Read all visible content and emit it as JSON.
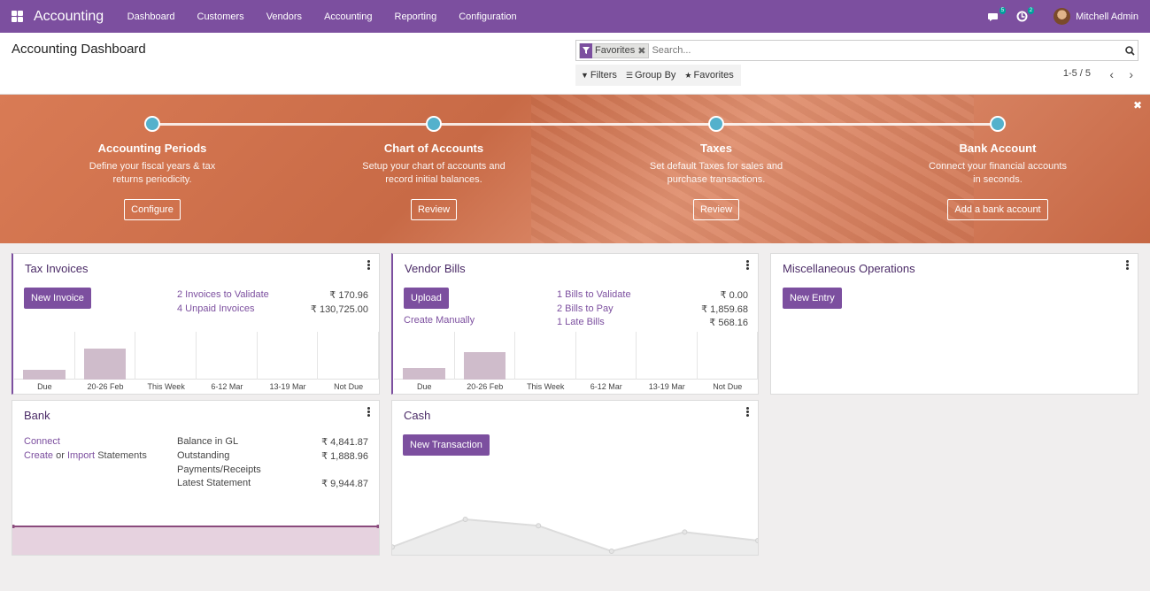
{
  "nav": {
    "app_name": "Accounting",
    "menu": [
      "Dashboard",
      "Customers",
      "Vendors",
      "Accounting",
      "Reporting",
      "Configuration"
    ],
    "messages_count": "5",
    "activities_count": "2",
    "user_name": "Mitchell Admin"
  },
  "control": {
    "title": "Accounting Dashboard",
    "facet_label": "Favorites",
    "search_placeholder": "Search...",
    "filters_label": "Filters",
    "groupby_label": "Group By",
    "favorites_label": "Favorites",
    "pager": "1-5 / 5"
  },
  "onboarding": {
    "steps": [
      {
        "title": "Accounting Periods",
        "desc": "Define your fiscal years & tax returns periodicity.",
        "button": "Configure"
      },
      {
        "title": "Chart of Accounts",
        "desc": "Setup your chart of accounts and record initial balances.",
        "button": "Review"
      },
      {
        "title": "Taxes",
        "desc": "Set default Taxes for sales and purchase transactions.",
        "button": "Review"
      },
      {
        "title": "Bank Account",
        "desc": "Connect your financial accounts in seconds.",
        "button": "Add a bank account"
      }
    ]
  },
  "tax_invoices": {
    "title": "Tax Invoices",
    "button": "New Invoice",
    "stats": [
      {
        "label": "2 Invoices to Validate",
        "value": "₹ 170.96"
      },
      {
        "label": "4 Unpaid Invoices",
        "value": "₹ 130,725.00"
      }
    ],
    "chart_categories": [
      "Due",
      "20-26 Feb",
      "This Week",
      "6-12 Mar",
      "13-19 Mar",
      "Not Due"
    ],
    "chart_values": [
      0.25,
      0.8,
      0,
      0,
      0,
      0
    ]
  },
  "vendor_bills": {
    "title": "Vendor Bills",
    "button": "Upload",
    "link": "Create Manually",
    "stats": [
      {
        "label": "1 Bills to Validate",
        "value": "₹ 0.00"
      },
      {
        "label": "2 Bills to Pay",
        "value": "₹ 1,859.68"
      },
      {
        "label": "1 Late Bills",
        "value": "₹ 568.16"
      }
    ],
    "chart_categories": [
      "Due",
      "20-26 Feb",
      "This Week",
      "6-12 Mar",
      "13-19 Mar",
      "Not Due"
    ],
    "chart_values": [
      0.3,
      0.7,
      0,
      0,
      0,
      0
    ]
  },
  "misc": {
    "title": "Miscellaneous Operations",
    "button": "New Entry"
  },
  "bank": {
    "title": "Bank",
    "connect": "Connect",
    "create": "Create",
    "or": "or",
    "import": "Import",
    "statements": "Statements",
    "stats": [
      {
        "label": "Balance in GL",
        "value": "₹ 4,841.87"
      },
      {
        "label": "Outstanding",
        "value": "₹ 1,888.96"
      },
      {
        "label": "Payments/Receipts",
        "value": ""
      },
      {
        "label": "Latest Statement",
        "value": "₹ 9,944.87"
      }
    ]
  },
  "cash": {
    "title": "Cash",
    "button": "New Transaction",
    "line_values": [
      0.1,
      0.75,
      0.6,
      0.0,
      0.45,
      0.25
    ]
  },
  "colors": {
    "brand": "#7c4f9f",
    "badge": "#00a09d",
    "bar": "#cfbccb"
  }
}
